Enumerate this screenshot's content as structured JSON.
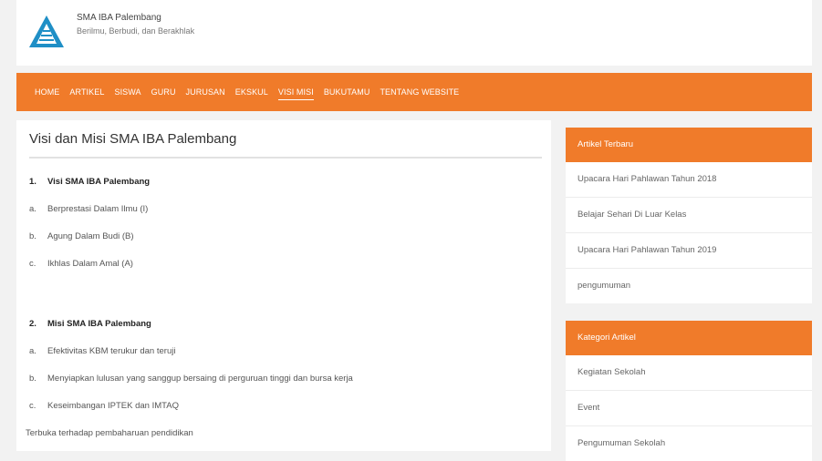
{
  "site": {
    "title": "SMA IBA Palembang",
    "tagline": "Berilmu, Berbudi, dan Berakhlak"
  },
  "nav": {
    "items": [
      "HOME",
      "ARTIKEL",
      "SISWA",
      "GURU",
      "JURUSAN",
      "EKSKUL",
      "VISI MISI",
      "BUKUTAMU",
      "TENTANG WEBSITE"
    ],
    "active": "VISI MISI"
  },
  "main": {
    "title": "Visi dan Misi SMA IBA Palembang",
    "visi": {
      "heading_num": "1.",
      "heading": "Visi SMA IBA Palembang",
      "items": [
        {
          "num": "a.",
          "text": "Berprestasi Dalam Ilmu (I)"
        },
        {
          "num": "b.",
          "text": "Agung Dalam Budi (B)"
        },
        {
          "num": "c.",
          "text": "Ikhlas Dalam Amal (A)"
        }
      ]
    },
    "misi": {
      "heading_num": "2.",
      "heading": "Misi SMA IBA Palembang",
      "items": [
        {
          "num": "a.",
          "text": "Efektivitas KBM terukur dan teruji"
        },
        {
          "num": "b.",
          "text": "Menyiapkan lulusan yang sanggup bersaing di perguruan tinggi dan bursa kerja"
        },
        {
          "num": "c.",
          "text": "Keseimbangan IPTEK dan IMTAQ"
        }
      ],
      "footer": "Terbuka terhadap pembaharuan pendidikan"
    }
  },
  "sidebar": {
    "latest": {
      "title": "Artikel Terbaru",
      "items": [
        "Upacara Hari Pahlawan Tahun 2018",
        "Belajar Sehari Di Luar Kelas",
        "Upacara Hari Pahlawan Tahun 2019",
        "pengumuman"
      ]
    },
    "categories": {
      "title": "Kategori Artikel",
      "items": [
        "Kegiatan Sekolah",
        "Event",
        "Pengumuman Sekolah"
      ]
    }
  },
  "colors": {
    "accent": "#f07b2a",
    "logo_blue": "#1f8fc6"
  }
}
